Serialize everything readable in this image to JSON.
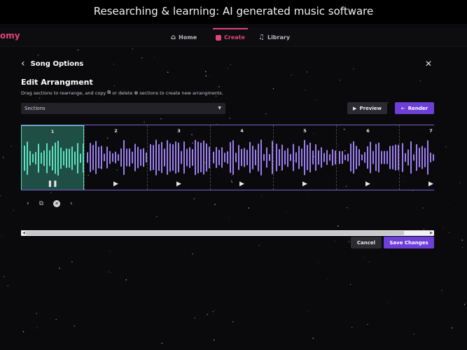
{
  "caption": "Researching & learning: AI generated music software",
  "brand": "omy",
  "nav": [
    {
      "label": "Home",
      "icon": "home-icon"
    },
    {
      "label": "Create",
      "icon": "create-icon",
      "active": true
    },
    {
      "label": "Library",
      "icon": "music-note-icon"
    }
  ],
  "panel": {
    "title": "Song Options",
    "section_title": "Edit Arrangment",
    "helper_parts": [
      "Drag sections to rearrange, and copy",
      "or delete",
      "sections to create new arrangments."
    ],
    "dropdown_value": "Sections",
    "preview_label": "Preview",
    "render_label": "Render"
  },
  "segments": [
    "1",
    "2",
    "3",
    "4",
    "5",
    "6",
    "7"
  ],
  "selected_segment": "1",
  "footer": {
    "cancel_label": "Cancel",
    "save_label": "Save Changes"
  },
  "colors": {
    "accent": "#6d3fd8",
    "brand": "#e0447a",
    "wave_selected": "#5fe0c0",
    "wave": "#9b7ff0"
  }
}
